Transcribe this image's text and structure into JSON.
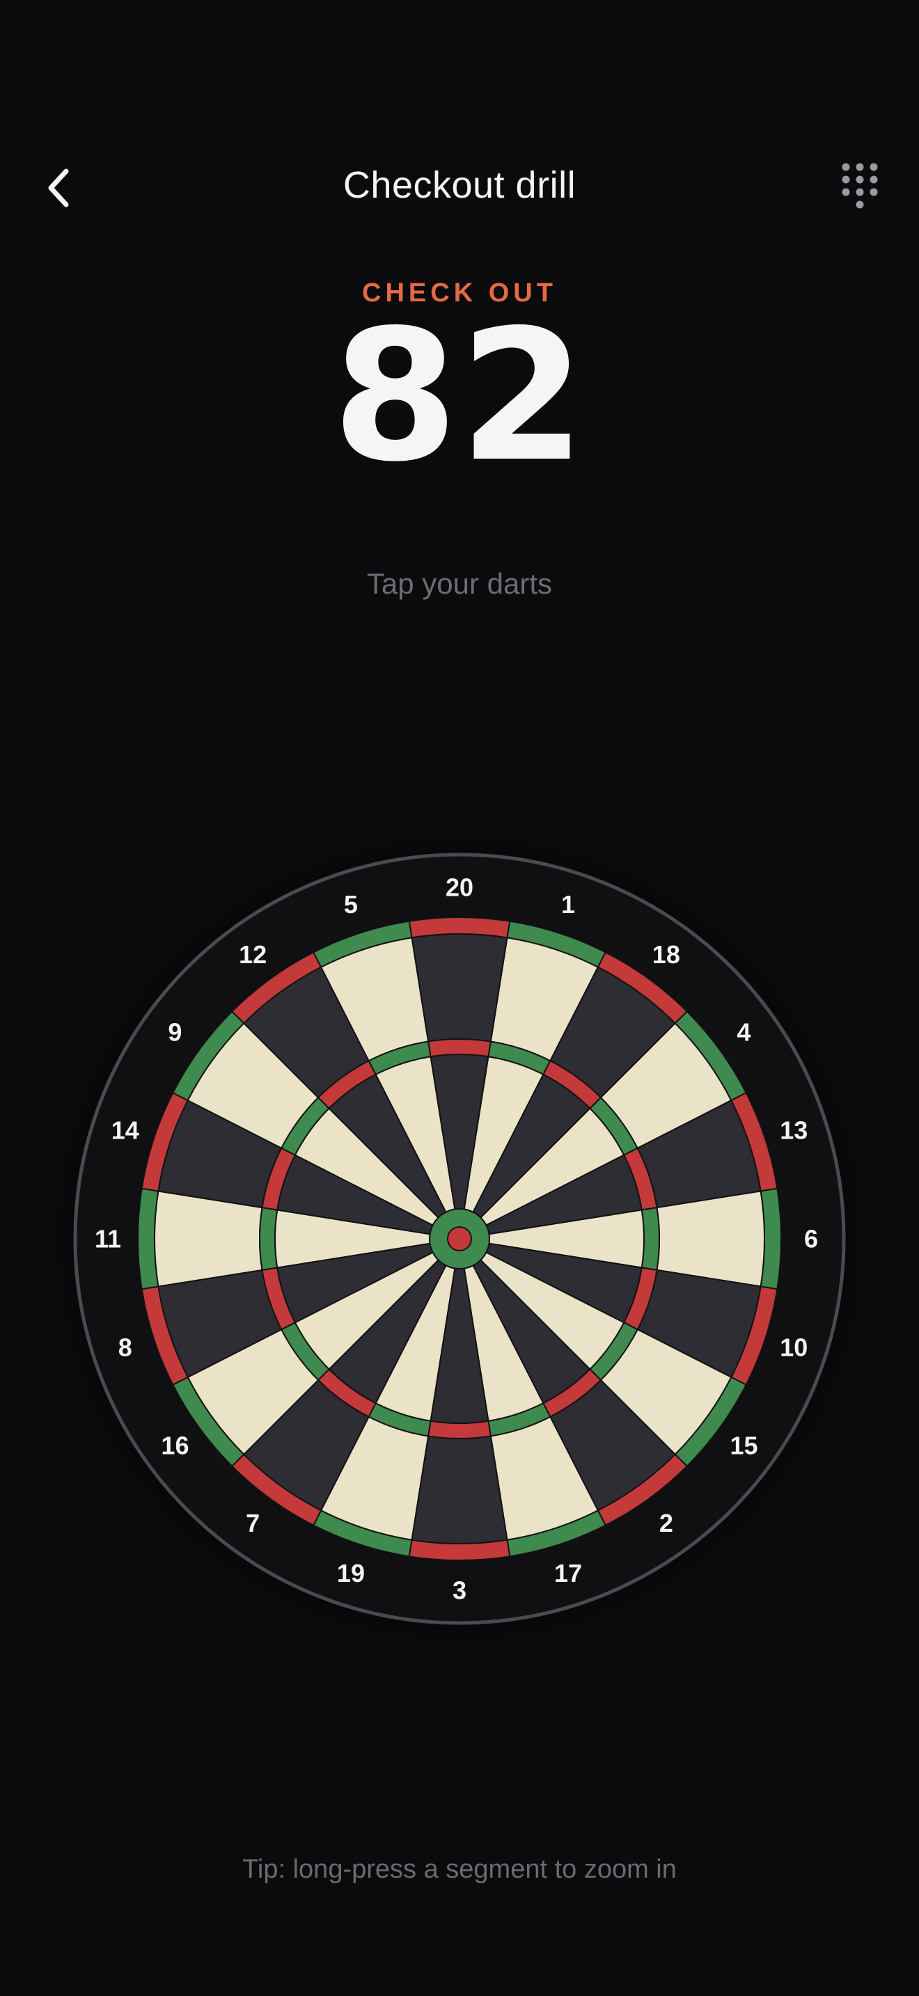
{
  "header": {
    "title": "Checkout drill",
    "back_icon": "chevron-left-icon",
    "keypad_icon": "dial-keypad-icon"
  },
  "checkout": {
    "label": "CHECK OUT",
    "score": "82"
  },
  "prompt": "Tap your darts",
  "tip": "Tip: long-press a segment to zoom in",
  "dartboard": {
    "numbers": [
      "20",
      "1",
      "18",
      "4",
      "13",
      "6",
      "10",
      "15",
      "2",
      "17",
      "3",
      "19",
      "7",
      "16",
      "8",
      "11",
      "14",
      "9",
      "12",
      "5"
    ],
    "colors": {
      "dark_segment": "#2e2d33",
      "light_segment": "#ebe3c7",
      "red": "#c43a3a",
      "green": "#3f8a4e",
      "outer_ring": "#101013",
      "number_text": "#f4f4f6"
    }
  },
  "colors": {
    "accent": "#e46a43",
    "background": "#0b0b0d"
  }
}
